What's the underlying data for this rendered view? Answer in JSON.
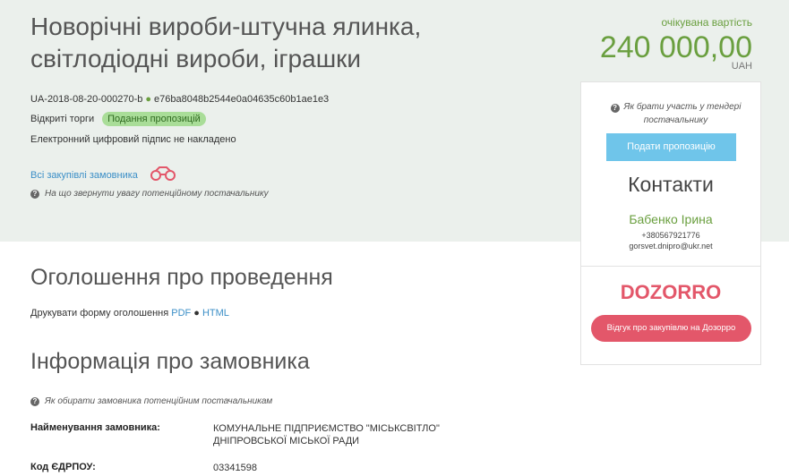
{
  "tender": {
    "title_line1": "Новорічні вироби-штучна ялинка,",
    "title_line2": "світлодіодні вироби, іграшки",
    "id": "UA-2018-08-20-000270-b",
    "hash": "e76ba8048b2544e0a04635c60b1ae1e3",
    "procedure": "Відкриті торги",
    "status": "Подання пропозицій",
    "signature": "Електронний цифровий підпис не накладено",
    "all_purchases_link": "Всі закупівлі замовника",
    "help_attention": "На що звернути увагу потенційному постачальнику"
  },
  "value": {
    "label": "очікувана вартість",
    "amount": "240 000,00",
    "currency": "UAH"
  },
  "sidebar": {
    "help_how": "Як брати участь у тендері постачальнику",
    "submit_button": "Подати пропозицію",
    "contacts_title": "Контакти",
    "contact_name": "Бабенко Ірина",
    "contact_phone": "+380567921776",
    "contact_email": "gorsvet.dnipro@ukr.net",
    "dozorro_logo_text": "DOZORRO",
    "review_button": "Відгук про закупівлю на Дозорро"
  },
  "announcement": {
    "title": "Оголошення про проведення",
    "print_label": "Друкувати форму оголошення",
    "pdf_link": "PDF",
    "separator": "●",
    "html_link": "HTML"
  },
  "customer": {
    "title": "Інформація про замовника",
    "help_choose": "Як обирати замовника потенційним постачальникам",
    "fields": [
      {
        "label": "Найменування замовника:",
        "value_line1": "КОМУНАЛЬНЕ ПІДПРИЄМСТВО \"МІСЬКСВІТЛО\"",
        "value_line2": "ДНІПРОВСЬКОЇ МІСЬКОЇ РАДИ"
      },
      {
        "label": "Код ЄДРПОУ:",
        "value_line1": "03341598"
      }
    ]
  },
  "colors": {
    "header_bg": "#ebf0ec",
    "accent_green": "#6a9f3f",
    "link_blue": "#3c8fc7",
    "submit_blue": "#6fc5ea",
    "dozorro_red": "#e3576a"
  },
  "icons": [
    "help-icon",
    "binoculars-icon",
    "dozorro-logo"
  ]
}
